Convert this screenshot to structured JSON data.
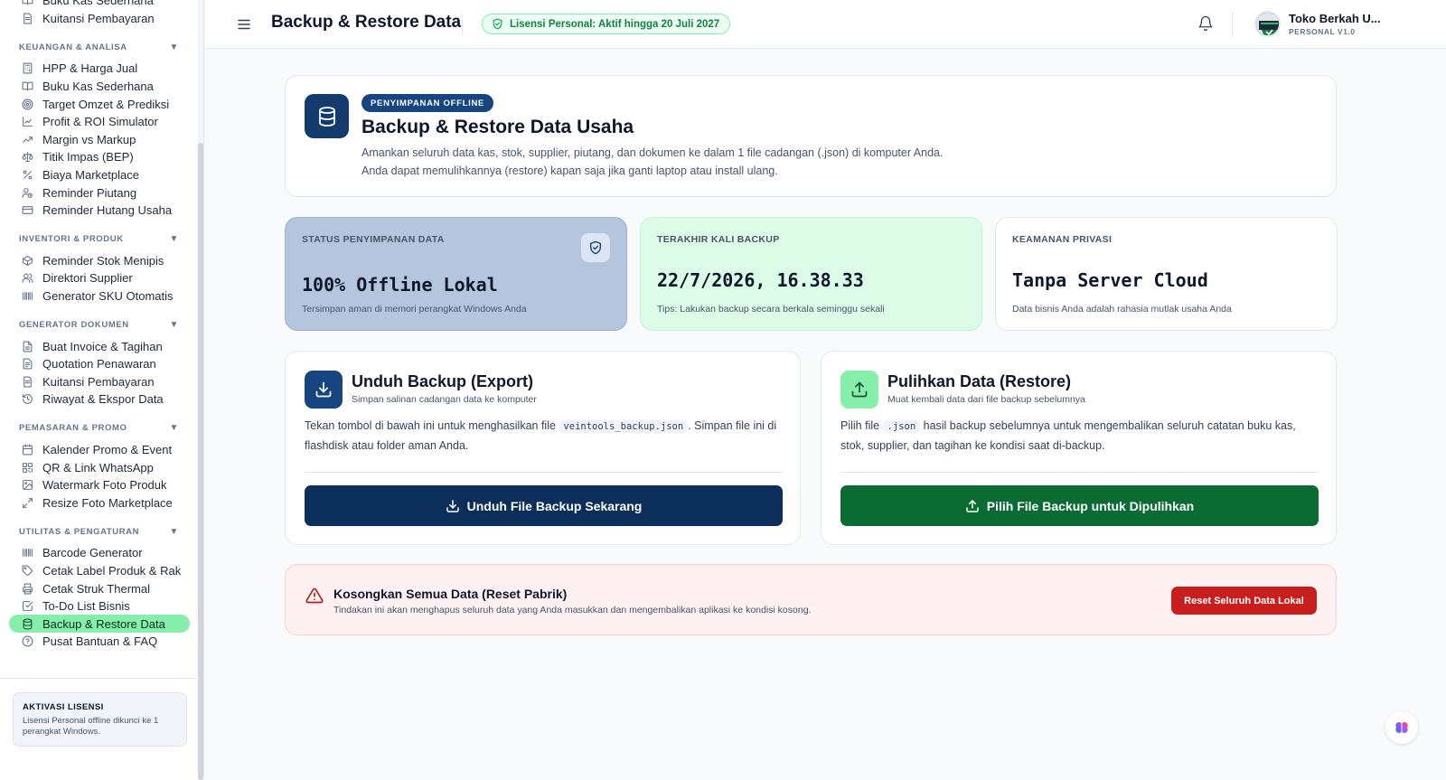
{
  "sidebar": {
    "top_items": [
      {
        "label": "Buku Kas Sederhana",
        "icon": "book-icon"
      },
      {
        "label": "Kuitansi Pembayaran",
        "icon": "receipt-icon"
      }
    ],
    "sections": [
      {
        "title": "KEUANGAN & ANALISA",
        "caret": "▼",
        "items": [
          {
            "label": "HPP & Harga Jual",
            "icon": "calculator-icon"
          },
          {
            "label": "Buku Kas Sederhana",
            "icon": "book-icon"
          },
          {
            "label": "Target Omzet & Prediksi",
            "icon": "target-icon"
          },
          {
            "label": "Profit & ROI Simulator",
            "icon": "chart-line-icon"
          },
          {
            "label": "Margin vs Markup",
            "icon": "trend-up-icon"
          },
          {
            "label": "Titik Impas (BEP)",
            "icon": "scale-icon"
          },
          {
            "label": "Biaya Marketplace",
            "icon": "percent-icon"
          },
          {
            "label": "Reminder Piutang",
            "icon": "user-clock-icon"
          },
          {
            "label": "Reminder Hutang Usaha",
            "icon": "credit-card-icon"
          }
        ]
      },
      {
        "title": "INVENTORI & PRODUK",
        "caret": "▼",
        "items": [
          {
            "label": "Reminder Stok Menipis",
            "icon": "package-icon"
          },
          {
            "label": "Direktori Supplier",
            "icon": "users-icon"
          },
          {
            "label": "Generator SKU Otomatis",
            "icon": "barcode-icon"
          }
        ]
      },
      {
        "title": "GENERATOR DOKUMEN",
        "caret": "▼",
        "items": [
          {
            "label": "Buat Invoice & Tagihan",
            "icon": "file-text-icon"
          },
          {
            "label": "Quotation Penawaran",
            "icon": "file-list-icon"
          },
          {
            "label": "Kuitansi Pembayaran",
            "icon": "receipt-icon"
          },
          {
            "label": "Riwayat & Ekspor Data",
            "icon": "history-icon"
          }
        ]
      },
      {
        "title": "PEMASARAN & PROMO",
        "caret": "▼",
        "items": [
          {
            "label": "Kalender Promo & Event",
            "icon": "calendar-icon"
          },
          {
            "label": "QR & Link WhatsApp",
            "icon": "qr-code-icon"
          },
          {
            "label": "Watermark Foto Produk",
            "icon": "image-icon"
          },
          {
            "label": "Resize Foto Marketplace",
            "icon": "resize-icon"
          }
        ]
      },
      {
        "title": "UTILITAS & PENGATURAN",
        "caret": "▼",
        "items": [
          {
            "label": "Barcode Generator",
            "icon": "barcode-icon"
          },
          {
            "label": "Cetak Label Produk & Rak",
            "icon": "tag-icon"
          },
          {
            "label": "Cetak Struk Thermal",
            "icon": "printer-icon"
          },
          {
            "label": "To-Do List Bisnis",
            "icon": "check-square-icon"
          },
          {
            "label": "Backup & Restore Data",
            "icon": "database-icon",
            "active": true
          },
          {
            "label": "Pusat Bantuan & FAQ",
            "icon": "help-circle-icon"
          }
        ]
      }
    ],
    "license": {
      "title": "AKTIVASI LISENSI",
      "text": "Lisensi Personal offline dikunci ke 1 perangkat Windows."
    }
  },
  "header": {
    "title": "Backup & Restore Data",
    "license_badge": "Lisensi Personal: Aktif hingga 20 Juli 2027",
    "store_name": "Toko Berkah U...",
    "store_version": "PERSONAL V1.0"
  },
  "hero": {
    "tag": "PENYIMPANAN OFFLINE",
    "title": "Backup & Restore Data Usaha",
    "desc_line1": "Amankan seluruh data kas, stok, supplier, piutang, dan dokumen ke dalam 1 file cadangan (.json) di komputer Anda.",
    "desc_line2": "Anda dapat memulihkannya (restore) kapan saja jika ganti laptop atau install ulang."
  },
  "stats": [
    {
      "label": "STATUS PENYIMPANAN DATA",
      "value": "100% Offline Lokal",
      "note": "Tersimpan aman di memori perangkat Windows Anda"
    },
    {
      "label": "TERAKHIR KALI BACKUP",
      "value": "22/7/2026, 16.38.33",
      "note": "Tips: Lakukan backup secara berkala seminggu sekali"
    },
    {
      "label": "KEAMANAN PRIVASI",
      "value": "Tanpa Server Cloud",
      "note": "Data bisnis Anda adalah rahasia mutlak usaha Anda"
    }
  ],
  "export": {
    "title": "Unduh Backup (Export)",
    "subtitle": "Simpan salinan cadangan data ke komputer",
    "body_before": "Tekan tombol di bawah ini untuk menghasilkan file ",
    "filename": "veintools_backup.json",
    "body_after": ". Simpan file ini di flashdisk atau folder aman Anda.",
    "button": "Unduh File Backup Sekarang"
  },
  "restore": {
    "title": "Pulihkan Data (Restore)",
    "subtitle": "Muat kembali data dari file backup sebelumnya",
    "body_before": "Pilih file ",
    "ext": ".json",
    "body_after": " hasil backup sebelumnya untuk mengembalikan seluruh catatan buku kas, stok, supplier, dan tagihan ke kondisi saat di-backup.",
    "button": "Pilih File Backup untuk Dipulihkan"
  },
  "danger": {
    "title": "Kosongkan Semua Data (Reset Pabrik)",
    "text": "Tindakan ini akan menghapus seluruh data yang Anda masukkan dan mengembalikan aplikasi ke kondisi kosong.",
    "button": "Reset Seluruh Data Lokal"
  },
  "colors": {
    "primary_navy": "#0b2e5a",
    "success_green": "#0a6b33",
    "active_highlight": "#86efac",
    "danger_red": "#c81e1e"
  }
}
